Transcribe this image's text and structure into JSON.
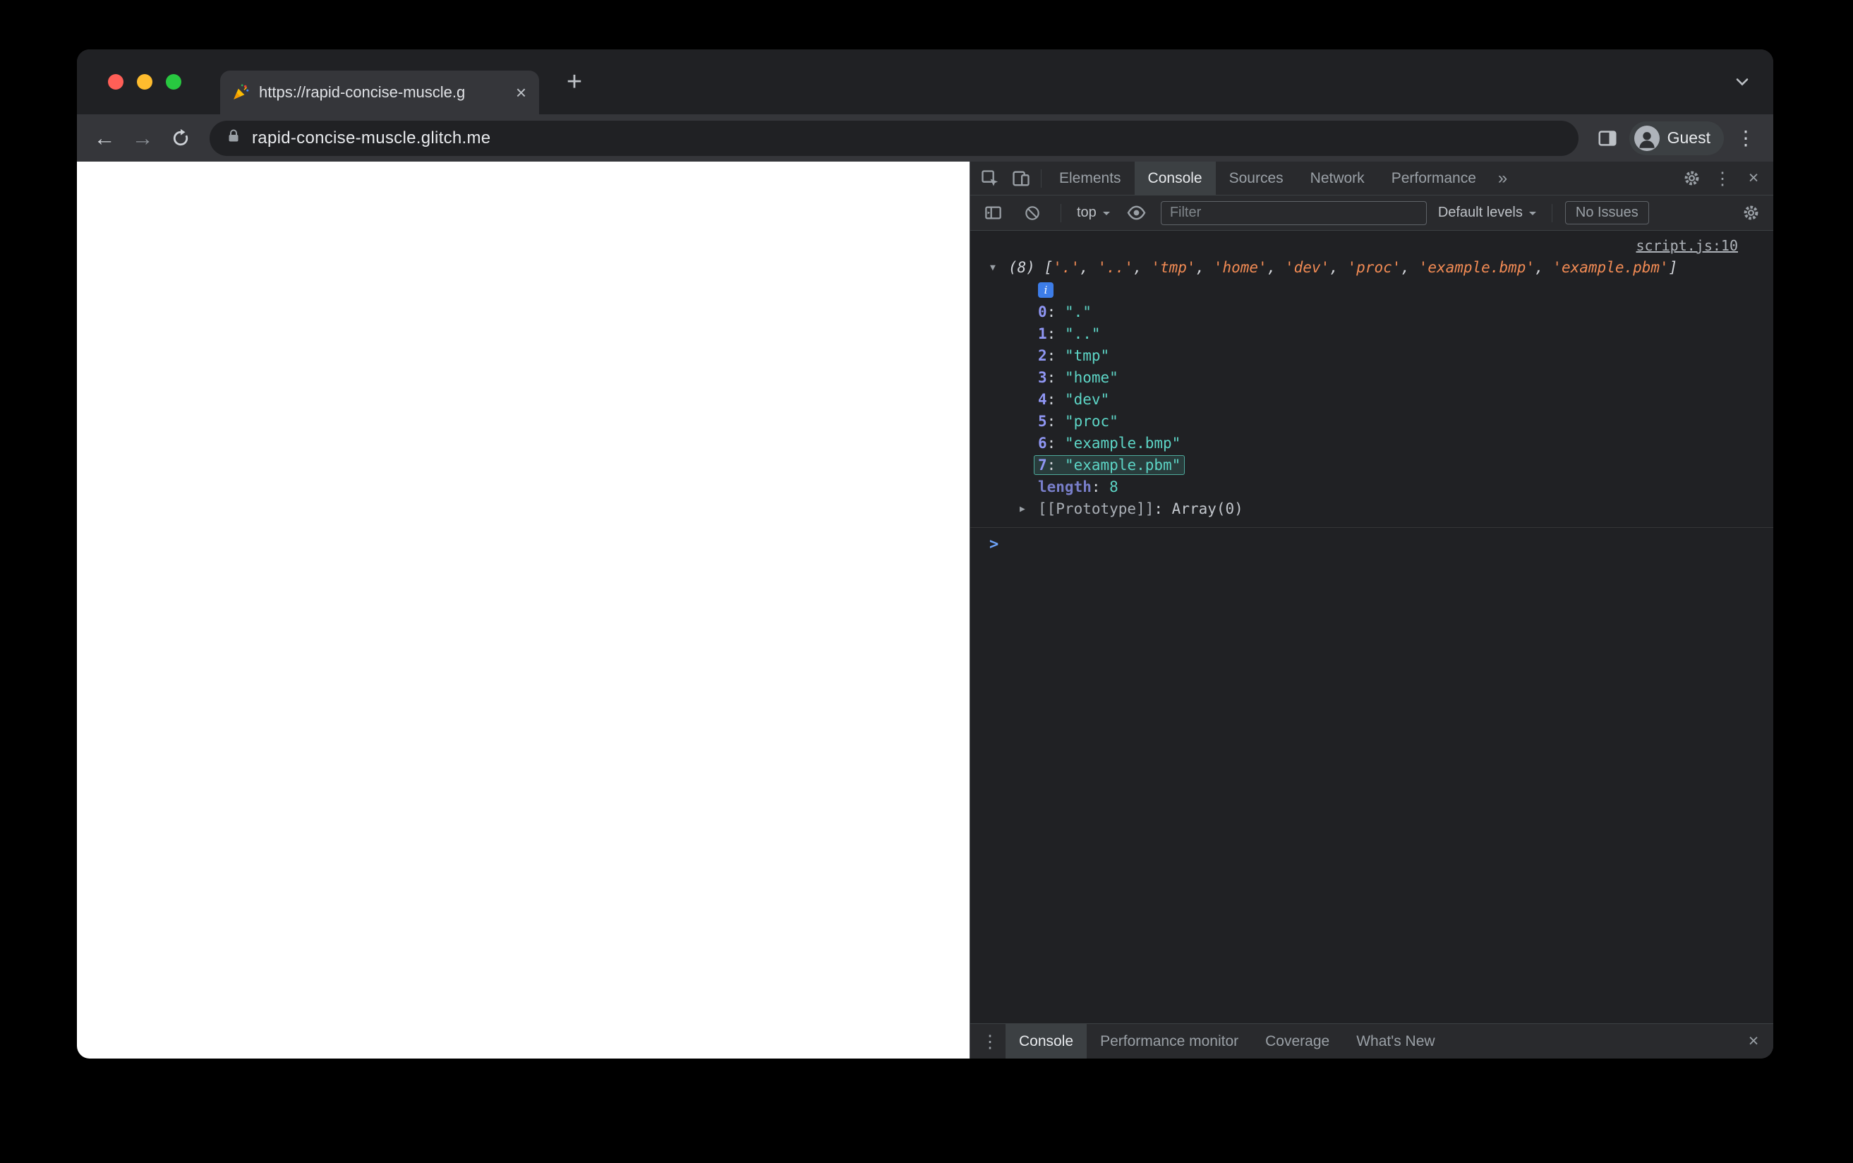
{
  "colors": {
    "accent_blue": "#6ea3f8",
    "string_teal": "#5dd5c6",
    "index_violet": "#8f96f3",
    "preview_orange": "#f28b54",
    "devtools_bg": "#202124",
    "devtools_bar": "#292a2d",
    "traffic_red": "#ff5f57",
    "traffic_yellow": "#febc2e",
    "traffic_green": "#28c840"
  },
  "browser": {
    "tab_title": "https://rapid-concise-muscle.g",
    "url": "rapid-concise-muscle.glitch.me",
    "guest_label": "Guest",
    "new_tab_glyph": "+",
    "close_tab_glyph": "×",
    "back_glyph": "←",
    "forward_glyph": "→",
    "menu_glyph": "⋮"
  },
  "devtools": {
    "tabs": [
      {
        "label": "Elements"
      },
      {
        "label": "Console",
        "active": true
      },
      {
        "label": "Sources"
      },
      {
        "label": "Network"
      },
      {
        "label": "Performance"
      }
    ],
    "tabbar": {
      "more_glyph": "»",
      "menu_glyph": "⋮",
      "close_glyph": "×"
    },
    "toolbar": {
      "context": "top",
      "filter_placeholder": "Filter",
      "levels_label": "Default levels",
      "issues_label": "No Issues"
    },
    "console": {
      "source_link": "script.js:10",
      "expand_glyph": "▼",
      "collapse_glyph": "▶",
      "info_glyph": "i",
      "preview_open": "(8) [",
      "preview_separator": ", ",
      "preview_close": "]",
      "preview_items": [
        "'.'",
        "'..'",
        "'tmp'",
        "'home'",
        "'dev'",
        "'proc'",
        "'example.bmp'",
        "'example.pbm'"
      ],
      "kv_separator": ": ",
      "items": [
        {
          "index": "0",
          "value": "\".\""
        },
        {
          "index": "1",
          "value": "\"..\""
        },
        {
          "index": "2",
          "value": "\"tmp\""
        },
        {
          "index": "3",
          "value": "\"home\""
        },
        {
          "index": "4",
          "value": "\"dev\""
        },
        {
          "index": "5",
          "value": "\"proc\""
        },
        {
          "index": "6",
          "value": "\"example.bmp\""
        },
        {
          "index": "7",
          "value": "\"example.pbm\"",
          "highlighted": true
        }
      ],
      "length_label": "length",
      "length_value": "8",
      "prototype_label": "[[Prototype]]",
      "prototype_value": "Array(0)",
      "prompt_glyph": ">"
    },
    "drawer": {
      "tabs": [
        {
          "label": "Console",
          "active": true
        },
        {
          "label": "Performance monitor"
        },
        {
          "label": "Coverage"
        },
        {
          "label": "What's New"
        }
      ],
      "menu_glyph": "⋮",
      "close_glyph": "×"
    }
  }
}
